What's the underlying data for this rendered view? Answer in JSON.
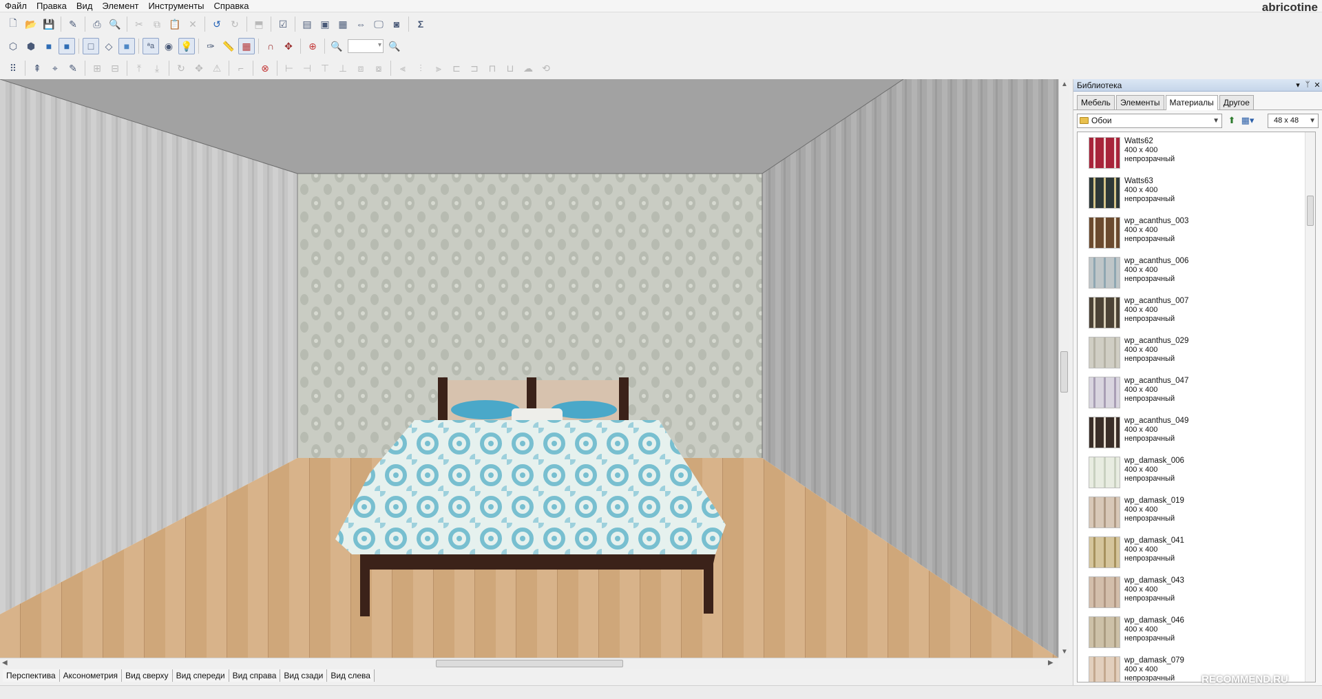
{
  "menu": [
    "Файл",
    "Правка",
    "Вид",
    "Элемент",
    "Инструменты",
    "Справка"
  ],
  "brand": "abricotine",
  "toolbar": {
    "zoom_value": ""
  },
  "view_tabs": [
    "Перспектива",
    "Аксонометрия",
    "Вид сверху",
    "Вид спереди",
    "Вид справа",
    "Вид сзади",
    "Вид слева"
  ],
  "library": {
    "title": "Библиотека",
    "tabs": [
      "Мебель",
      "Элементы",
      "Материалы",
      "Другое"
    ],
    "active_tab": "Материалы",
    "folder": "Обои",
    "thumb_size": "48 x 48",
    "items": [
      {
        "name": "Watts62",
        "size": "400 x 400",
        "opacity": "непрозрачный",
        "colors": [
          "#a8243a",
          "#f2d7d7"
        ]
      },
      {
        "name": "Watts63",
        "size": "400 x 400",
        "opacity": "непрозрачный",
        "colors": [
          "#2d3837",
          "#d4c48a"
        ]
      },
      {
        "name": "wp_acanthus_003",
        "size": "400 x 400",
        "opacity": "непрозрачный",
        "colors": [
          "#6b4a2e",
          "#e8dcc8"
        ]
      },
      {
        "name": "wp_acanthus_006",
        "size": "400 x 400",
        "opacity": "непрозрачный",
        "colors": [
          "#bfc6c8",
          "#8fa7b2"
        ]
      },
      {
        "name": "wp_acanthus_007",
        "size": "400 x 400",
        "opacity": "непрозрачный",
        "colors": [
          "#4c4336",
          "#d8cfb8"
        ]
      },
      {
        "name": "wp_acanthus_029",
        "size": "400 x 400",
        "opacity": "непрозрачный",
        "colors": [
          "#d0cec4",
          "#b6b3a6"
        ]
      },
      {
        "name": "wp_acanthus_047",
        "size": "400 x 400",
        "opacity": "непрозрачный",
        "colors": [
          "#d9d5df",
          "#a99fb5"
        ]
      },
      {
        "name": "wp_acanthus_049",
        "size": "400 x 400",
        "opacity": "непрозрачный",
        "colors": [
          "#3a2e28",
          "#e6ddcf"
        ]
      },
      {
        "name": "wp_damask_006",
        "size": "400 x 400",
        "opacity": "непрозрачный",
        "colors": [
          "#e8ece1",
          "#c9d1c0"
        ]
      },
      {
        "name": "wp_damask_019",
        "size": "400 x 400",
        "opacity": "непрозрачный",
        "colors": [
          "#d8c8b8",
          "#b09b86"
        ]
      },
      {
        "name": "wp_damask_041",
        "size": "400 x 400",
        "opacity": "непрозрачный",
        "colors": [
          "#d5c59c",
          "#a7925e"
        ]
      },
      {
        "name": "wp_damask_043",
        "size": "400 x 400",
        "opacity": "непрозрачный",
        "colors": [
          "#d3beab",
          "#b19884"
        ]
      },
      {
        "name": "wp_damask_046",
        "size": "400 x 400",
        "opacity": "непрозрачный",
        "colors": [
          "#cdc1a8",
          "#ab9d82"
        ]
      },
      {
        "name": "wp_damask_079",
        "size": "400 x 400",
        "opacity": "непрозрачный",
        "colors": [
          "#e2cfbd",
          "#c4a98f"
        ]
      }
    ]
  },
  "watermark": "RECOMMEND.RU",
  "colors": {
    "ceiling": "#a2a2a2",
    "back_wall": "#c7cac0",
    "side_wall": "#c4c4c4",
    "floor": "#cfa77a",
    "bedspread": "#8ec5d4",
    "bed_frame": "#3b2219",
    "pillow": "#4aa8c9"
  }
}
